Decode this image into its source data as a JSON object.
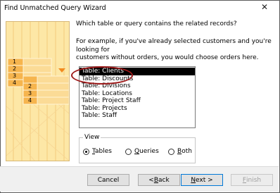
{
  "window": {
    "title": "Find Unmatched Query Wizard",
    "close_glyph": "✕"
  },
  "wizard": {
    "question": "Which table or query contains the related records?",
    "example_line1": "For example, if you've already selected customers and you're looking for",
    "example_line2": "customers without orders, you would choose orders here."
  },
  "illustration": {
    "row_numbers": [
      "1",
      "2",
      "3",
      "4"
    ],
    "accent_color": "#f28a1e",
    "fill_color": "#fde7a6"
  },
  "list": {
    "items": [
      {
        "label": "Table: Clients",
        "selected": true
      },
      {
        "label": "Table: Discounts",
        "selected": false
      },
      {
        "label": "Table: Divisions",
        "selected": false
      },
      {
        "label": "Table: Locations",
        "selected": false
      },
      {
        "label": "Table: Project Staff",
        "selected": false
      },
      {
        "label": "Table: Projects",
        "selected": false
      },
      {
        "label": "Table: Staff",
        "selected": false
      }
    ]
  },
  "view_group": {
    "legend": "View",
    "options": [
      {
        "hotkey": "T",
        "rest": "ables",
        "checked": true
      },
      {
        "hotkey": "Q",
        "rest": "ueries",
        "checked": false
      },
      {
        "hotkey": "B",
        "rest": "oth",
        "checked": false
      }
    ]
  },
  "buttons": {
    "cancel": "Cancel",
    "back_prefix": "< ",
    "back_hotkey": "B",
    "back_rest": "ack",
    "next_hotkey": "N",
    "next_rest": "ext >",
    "finish_hotkey": "F",
    "finish_rest": "inish"
  },
  "colors": {
    "selection_bg": "#000000",
    "annotation_oval": "#9d1a1a",
    "default_button_border": "#0078d7"
  }
}
